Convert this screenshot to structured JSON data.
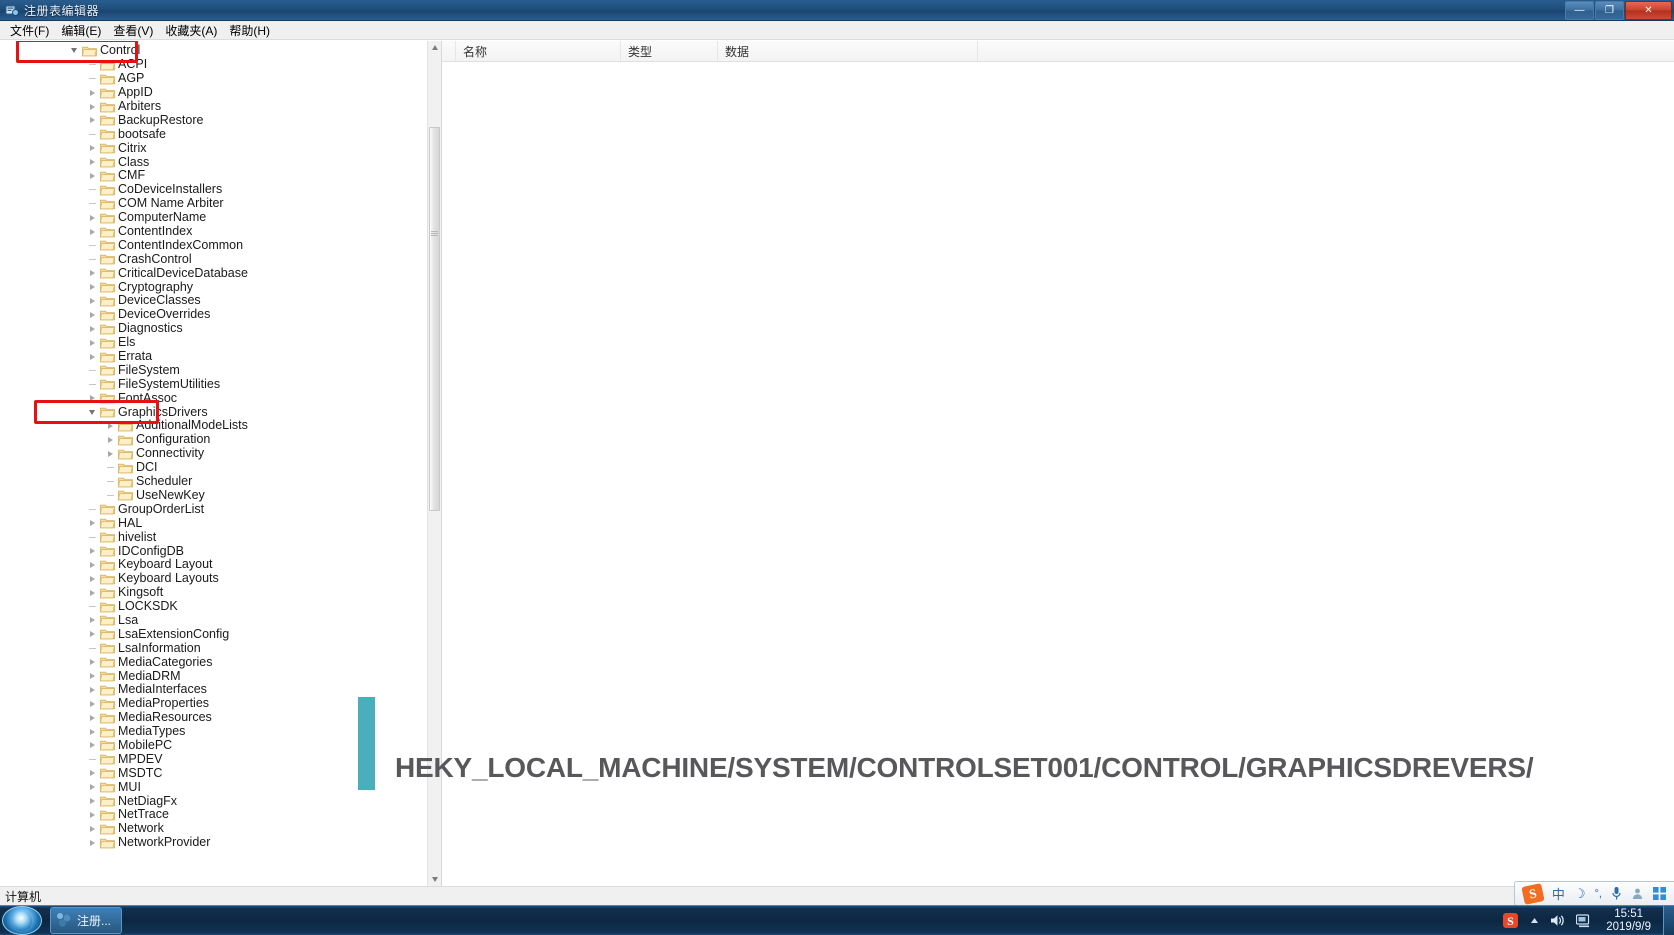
{
  "window": {
    "title": "注册表编辑器",
    "icon": "registry-editor-icon",
    "buttons": {
      "minimize": "—",
      "restore": "❐",
      "close": "✕"
    }
  },
  "menu": {
    "items": [
      {
        "label": "文件(F)",
        "name": "menu-file"
      },
      {
        "label": "编辑(E)",
        "name": "menu-edit"
      },
      {
        "label": "查看(V)",
        "name": "menu-view"
      },
      {
        "label": "收藏夹(A)",
        "name": "menu-favorites"
      },
      {
        "label": "帮助(H)",
        "name": "menu-help"
      }
    ]
  },
  "tree": {
    "items": [
      {
        "label": "Control",
        "indent": 0,
        "state": "expanded"
      },
      {
        "label": "ACPI",
        "indent": 1,
        "state": "leaf"
      },
      {
        "label": "AGP",
        "indent": 1,
        "state": "leaf"
      },
      {
        "label": "AppID",
        "indent": 1,
        "state": "collapsed"
      },
      {
        "label": "Arbiters",
        "indent": 1,
        "state": "collapsed"
      },
      {
        "label": "BackupRestore",
        "indent": 1,
        "state": "collapsed"
      },
      {
        "label": "bootsafe",
        "indent": 1,
        "state": "leaf"
      },
      {
        "label": "Citrix",
        "indent": 1,
        "state": "collapsed"
      },
      {
        "label": "Class",
        "indent": 1,
        "state": "collapsed"
      },
      {
        "label": "CMF",
        "indent": 1,
        "state": "collapsed"
      },
      {
        "label": "CoDeviceInstallers",
        "indent": 1,
        "state": "leaf"
      },
      {
        "label": "COM Name Arbiter",
        "indent": 1,
        "state": "leaf"
      },
      {
        "label": "ComputerName",
        "indent": 1,
        "state": "collapsed"
      },
      {
        "label": "ContentIndex",
        "indent": 1,
        "state": "collapsed"
      },
      {
        "label": "ContentIndexCommon",
        "indent": 1,
        "state": "leaf"
      },
      {
        "label": "CrashControl",
        "indent": 1,
        "state": "leaf"
      },
      {
        "label": "CriticalDeviceDatabase",
        "indent": 1,
        "state": "collapsed"
      },
      {
        "label": "Cryptography",
        "indent": 1,
        "state": "collapsed"
      },
      {
        "label": "DeviceClasses",
        "indent": 1,
        "state": "collapsed"
      },
      {
        "label": "DeviceOverrides",
        "indent": 1,
        "state": "collapsed"
      },
      {
        "label": "Diagnostics",
        "indent": 1,
        "state": "collapsed"
      },
      {
        "label": "Els",
        "indent": 1,
        "state": "collapsed"
      },
      {
        "label": "Errata",
        "indent": 1,
        "state": "collapsed"
      },
      {
        "label": "FileSystem",
        "indent": 1,
        "state": "leaf"
      },
      {
        "label": "FileSystemUtilities",
        "indent": 1,
        "state": "leaf"
      },
      {
        "label": "FontAssoc",
        "indent": 1,
        "state": "collapsed"
      },
      {
        "label": "GraphicsDrivers",
        "indent": 1,
        "state": "expanded"
      },
      {
        "label": "AdditionalModeLists",
        "indent": 2,
        "state": "collapsed"
      },
      {
        "label": "Configuration",
        "indent": 2,
        "state": "collapsed"
      },
      {
        "label": "Connectivity",
        "indent": 2,
        "state": "collapsed"
      },
      {
        "label": "DCI",
        "indent": 2,
        "state": "leaf"
      },
      {
        "label": "Scheduler",
        "indent": 2,
        "state": "leaf"
      },
      {
        "label": "UseNewKey",
        "indent": 2,
        "state": "leaf"
      },
      {
        "label": "GroupOrderList",
        "indent": 1,
        "state": "leaf"
      },
      {
        "label": "HAL",
        "indent": 1,
        "state": "collapsed"
      },
      {
        "label": "hivelist",
        "indent": 1,
        "state": "leaf"
      },
      {
        "label": "IDConfigDB",
        "indent": 1,
        "state": "collapsed"
      },
      {
        "label": "Keyboard Layout",
        "indent": 1,
        "state": "collapsed"
      },
      {
        "label": "Keyboard Layouts",
        "indent": 1,
        "state": "collapsed"
      },
      {
        "label": "Kingsoft",
        "indent": 1,
        "state": "collapsed"
      },
      {
        "label": "LOCKSDK",
        "indent": 1,
        "state": "leaf"
      },
      {
        "label": "Lsa",
        "indent": 1,
        "state": "collapsed"
      },
      {
        "label": "LsaExtensionConfig",
        "indent": 1,
        "state": "collapsed"
      },
      {
        "label": "LsaInformation",
        "indent": 1,
        "state": "leaf"
      },
      {
        "label": "MediaCategories",
        "indent": 1,
        "state": "collapsed"
      },
      {
        "label": "MediaDRM",
        "indent": 1,
        "state": "collapsed"
      },
      {
        "label": "MediaInterfaces",
        "indent": 1,
        "state": "collapsed"
      },
      {
        "label": "MediaProperties",
        "indent": 1,
        "state": "collapsed"
      },
      {
        "label": "MediaResources",
        "indent": 1,
        "state": "collapsed"
      },
      {
        "label": "MediaTypes",
        "indent": 1,
        "state": "collapsed"
      },
      {
        "label": "MobilePC",
        "indent": 1,
        "state": "collapsed"
      },
      {
        "label": "MPDEV",
        "indent": 1,
        "state": "leaf"
      },
      {
        "label": "MSDTC",
        "indent": 1,
        "state": "collapsed"
      },
      {
        "label": "MUI",
        "indent": 1,
        "state": "collapsed"
      },
      {
        "label": "NetDiagFx",
        "indent": 1,
        "state": "collapsed"
      },
      {
        "label": "NetTrace",
        "indent": 1,
        "state": "collapsed"
      },
      {
        "label": "Network",
        "indent": 1,
        "state": "collapsed"
      },
      {
        "label": "NetworkProvider",
        "indent": 1,
        "state": "collapsed"
      }
    ]
  },
  "list": {
    "columns": [
      {
        "label": "名称"
      },
      {
        "label": "类型"
      },
      {
        "label": "数据"
      }
    ],
    "rows": []
  },
  "annotations": {
    "highlight_color": "#e81010",
    "bar_color": "#4aafbd",
    "overlay_text": "HEKY_LOCAL_MACHINE/SYSTEM/CONTROLSET001/CONTROL/GRAPHICSDREVERS/",
    "boxes": [
      {
        "target": "Control"
      },
      {
        "target": "GraphicsDrivers"
      }
    ]
  },
  "status_bar": {
    "text": "计算机"
  },
  "ime_bar": {
    "items": [
      {
        "name": "sogou-logo-icon",
        "glyph": "S"
      },
      {
        "name": "chinese-mode-icon",
        "glyph": "中"
      },
      {
        "name": "moon-icon",
        "glyph": "☽"
      },
      {
        "name": "punctuation-icon",
        "glyph": "°,"
      },
      {
        "name": "microphone-icon",
        "glyph": "🎤"
      },
      {
        "name": "user-icon",
        "glyph": "☻"
      },
      {
        "name": "toolbox-icon",
        "glyph": "⊞"
      }
    ]
  },
  "taskbar": {
    "start_button": "start-orb",
    "task_button_label": "注册...",
    "tray": [
      {
        "name": "sogou-tray-icon",
        "glyph": "S"
      },
      {
        "name": "show-hidden-icons-icon",
        "glyph": "▲"
      },
      {
        "name": "volume-icon",
        "glyph": "🔊"
      },
      {
        "name": "network-icon",
        "glyph": "🖥"
      }
    ],
    "clock_time": "15:51",
    "clock_date": "2019/9/9"
  }
}
